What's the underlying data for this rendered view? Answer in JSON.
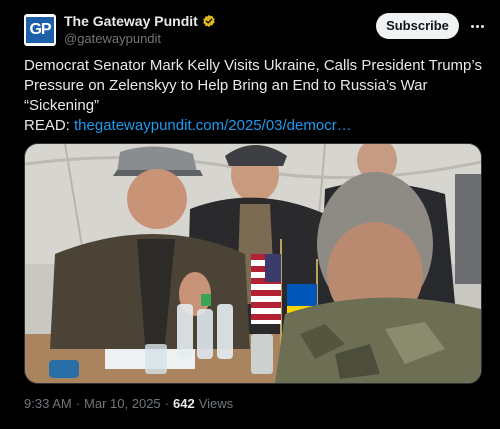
{
  "author": {
    "avatar_text": "GP",
    "name": "The Gateway Pundit",
    "handle": "@gatewaypundit",
    "verified_icon": "verified-badge-gold"
  },
  "subscribe_label": "Subscribe",
  "tweet": {
    "headline": "Democrat Senator Mark Kelly Visits Ukraine, Calls President Trump’s Pressure on Zelenskyy to Help Bring an End to Russia’s War “Sickening”",
    "read_prefix": "READ:",
    "read_link": "thegatewaypundit.com/2025/03/democr…"
  },
  "meta": {
    "time": "9:33 AM",
    "separator": "·",
    "date": "Mar 10, 2025",
    "separator2": "·",
    "views_count": "642",
    "views_label": "Views"
  },
  "colors": {
    "background": "#000000",
    "text": "#e7e9ea",
    "muted": "#71767b",
    "link": "#1d9bf0",
    "badge": "#e2b719"
  }
}
